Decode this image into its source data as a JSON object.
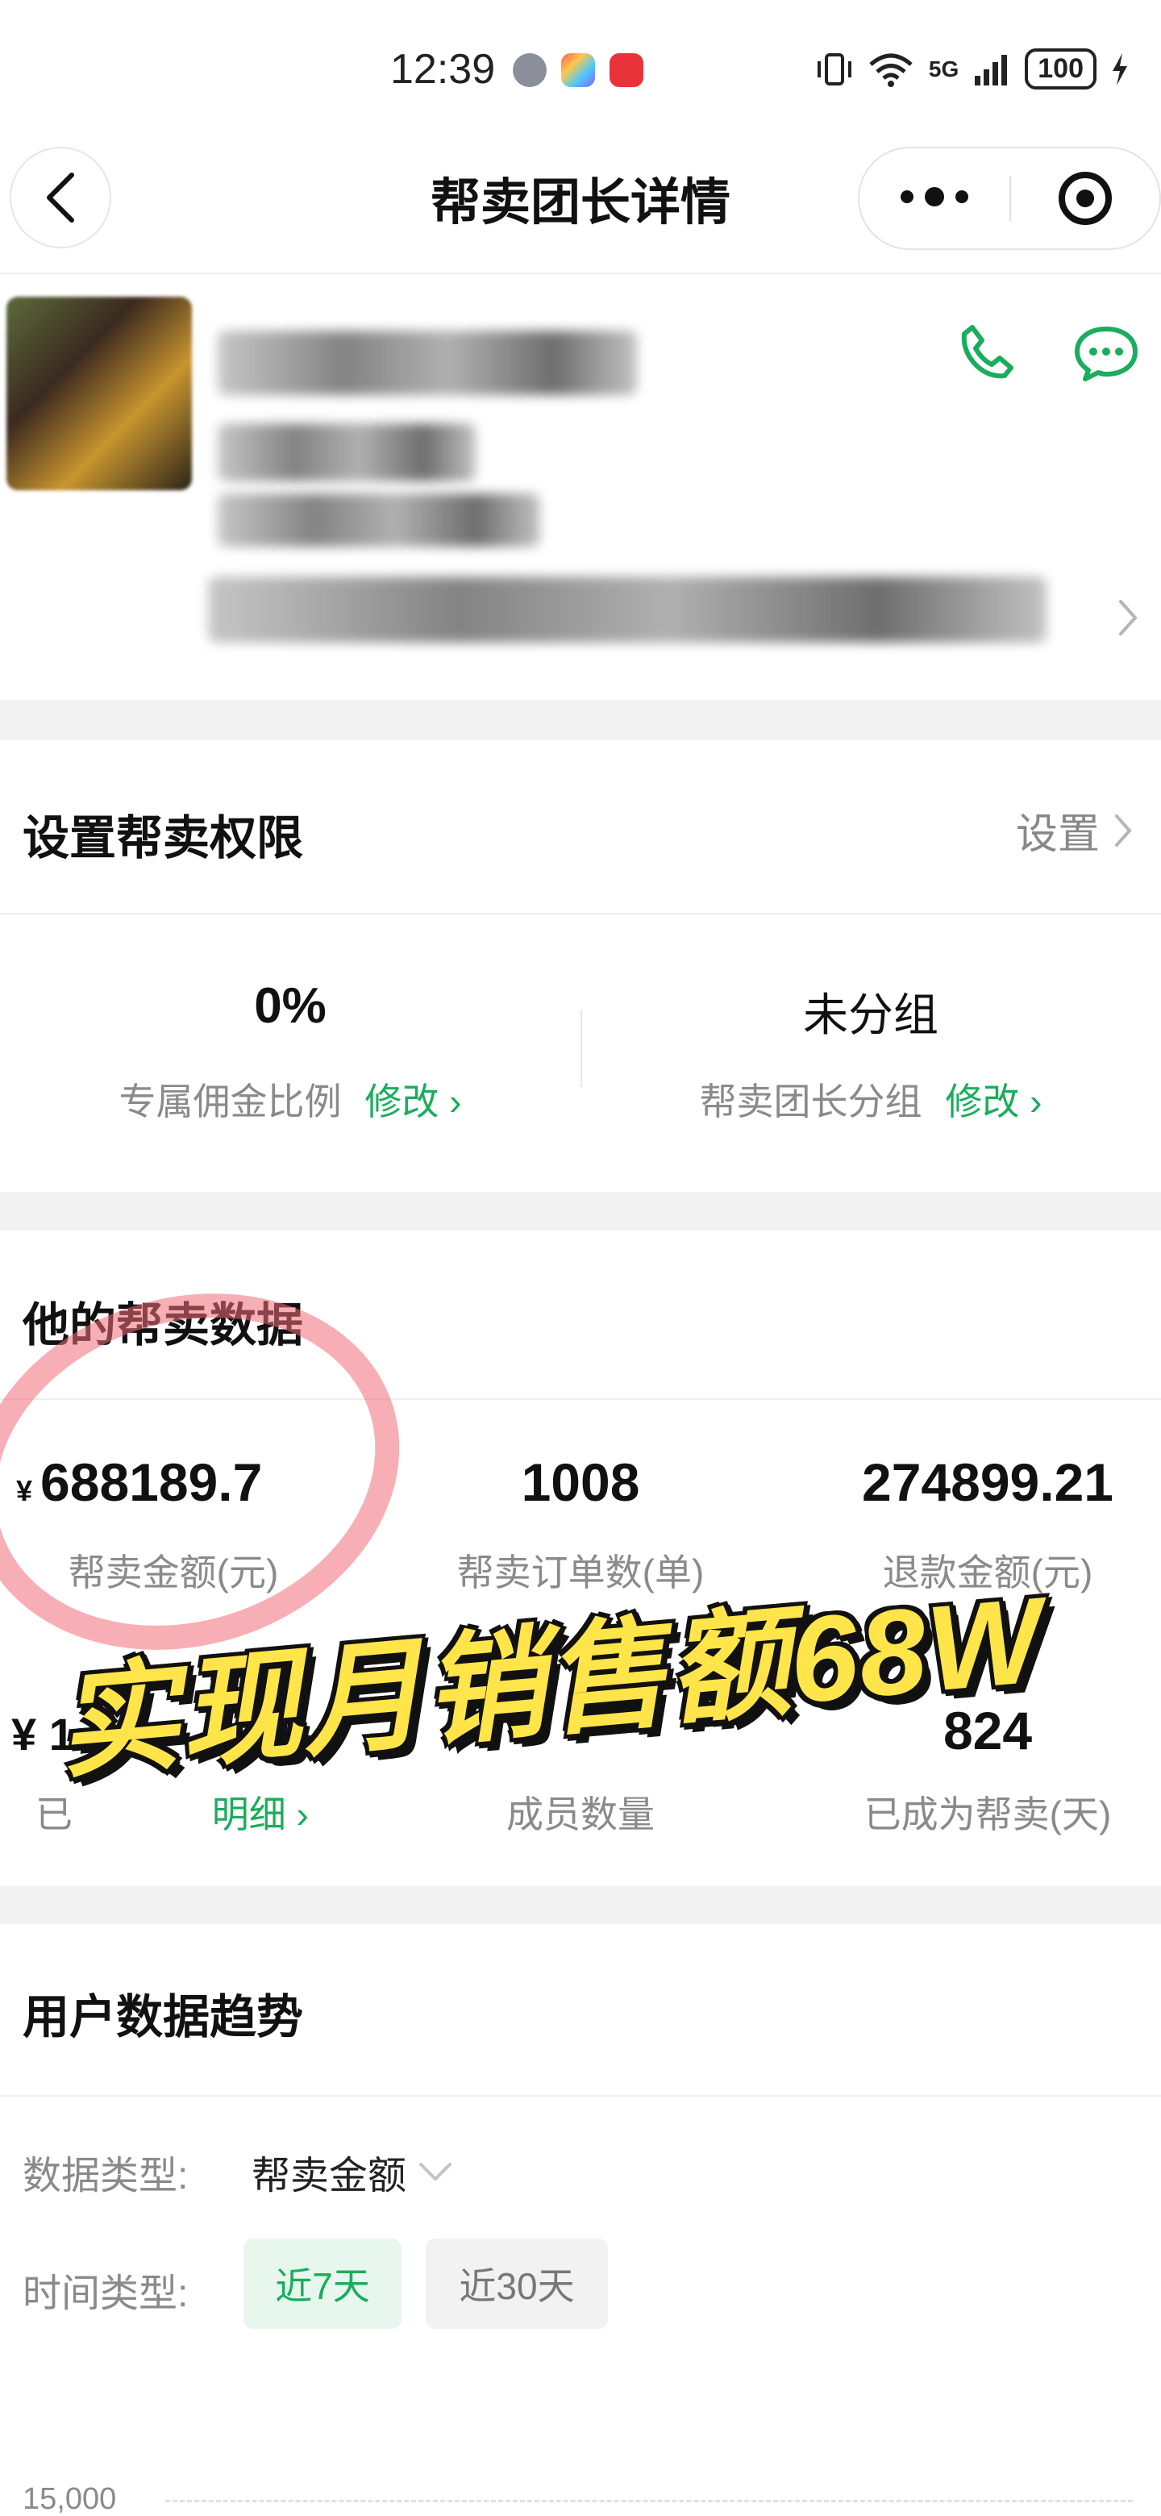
{
  "status_bar": {
    "time": "12:39",
    "network": "5G",
    "battery": "100",
    "icons": [
      "vibrate-icon",
      "wifi-icon",
      "signal-icon",
      "charging-icon"
    ]
  },
  "nav": {
    "title": "帮卖团长详情"
  },
  "permission": {
    "title": "设置帮卖权限",
    "action_label": "设置",
    "commission_value": "0%",
    "commission_label": "专属佣金比例",
    "commission_edit": "修改",
    "group_value": "未分组",
    "group_label": "帮卖团长分组",
    "group_edit": "修改"
  },
  "sales": {
    "title": "他的帮卖数据",
    "currency_symbol": "¥",
    "amount_value": "688189.7",
    "amount_label": "帮卖金额(元)",
    "orders_value": "1008",
    "orders_label": "帮卖订单数(单)",
    "refund_value": "274899.21",
    "refund_label": "退款金额(元)",
    "commission_prefix": "¥ 1",
    "commission_label": "已",
    "commission_link": "明细",
    "members_label": "成员数量",
    "days_value": "824",
    "days_label": "已成为帮卖(天)"
  },
  "trend": {
    "title": "用户数据趋势",
    "data_type_label": "数据类型:",
    "data_type_value": "帮卖金额",
    "time_type_label": "时间类型:",
    "range_options": [
      "近7天",
      "近30天"
    ],
    "selected_range": "近7天",
    "y_tick_top": "15,000"
  },
  "overlay": {
    "caption": "实现月销售额68W"
  },
  "colors": {
    "accent_green": "#1aad5c",
    "overlay_yellow": "#ffe54a",
    "annotation_red": "#f06e78"
  }
}
